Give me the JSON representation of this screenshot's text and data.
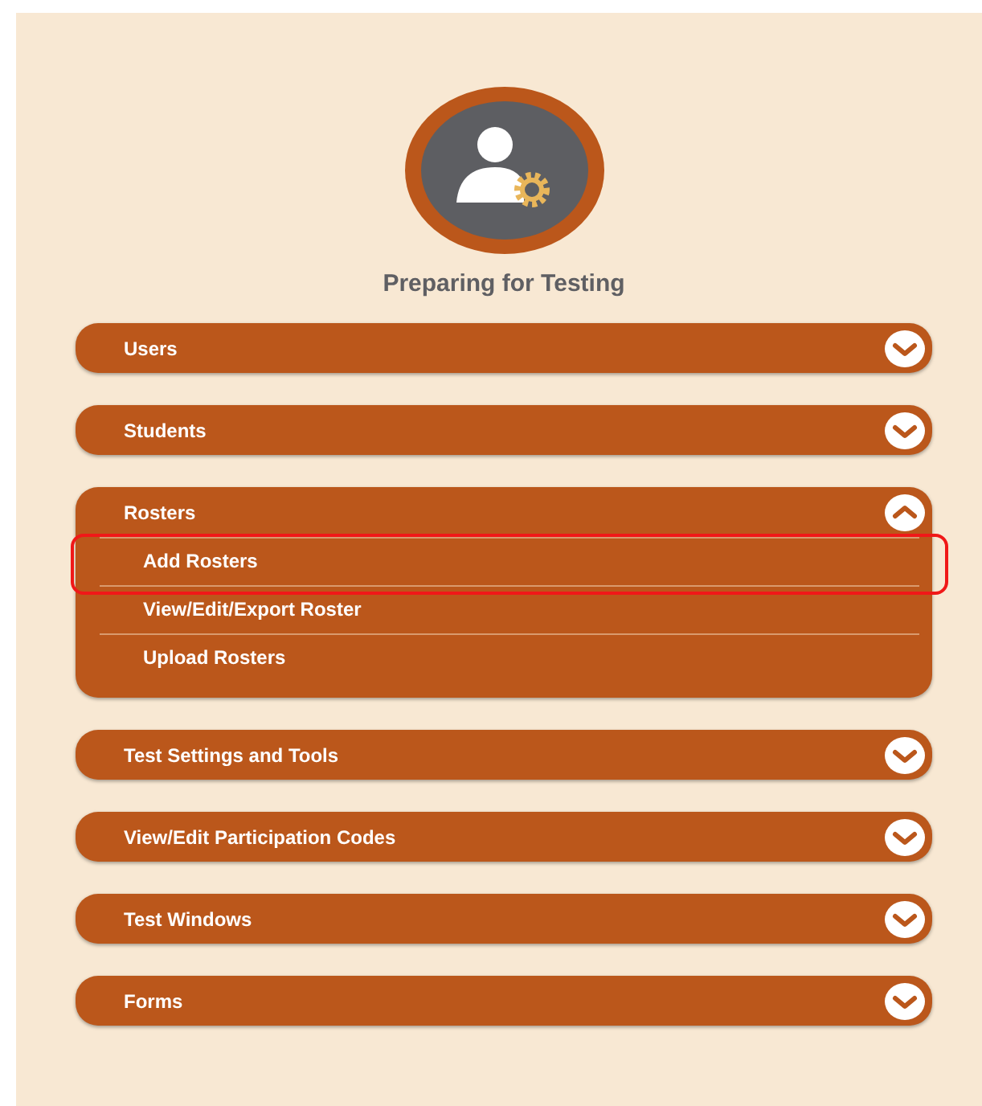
{
  "heading": "Preparing for Testing",
  "sections": [
    {
      "label": "Users",
      "expanded": false
    },
    {
      "label": "Students",
      "expanded": false
    },
    {
      "label": "Rosters",
      "expanded": true,
      "items": [
        {
          "label": "Add Rosters",
          "highlighted": true
        },
        {
          "label": "View/Edit/Export Roster",
          "highlighted": false
        },
        {
          "label": "Upload Rosters",
          "highlighted": false
        }
      ]
    },
    {
      "label": "Test Settings and Tools",
      "expanded": false
    },
    {
      "label": "View/Edit Participation Codes",
      "expanded": false
    },
    {
      "label": "Test Windows",
      "expanded": false
    },
    {
      "label": "Forms",
      "expanded": false
    }
  ]
}
